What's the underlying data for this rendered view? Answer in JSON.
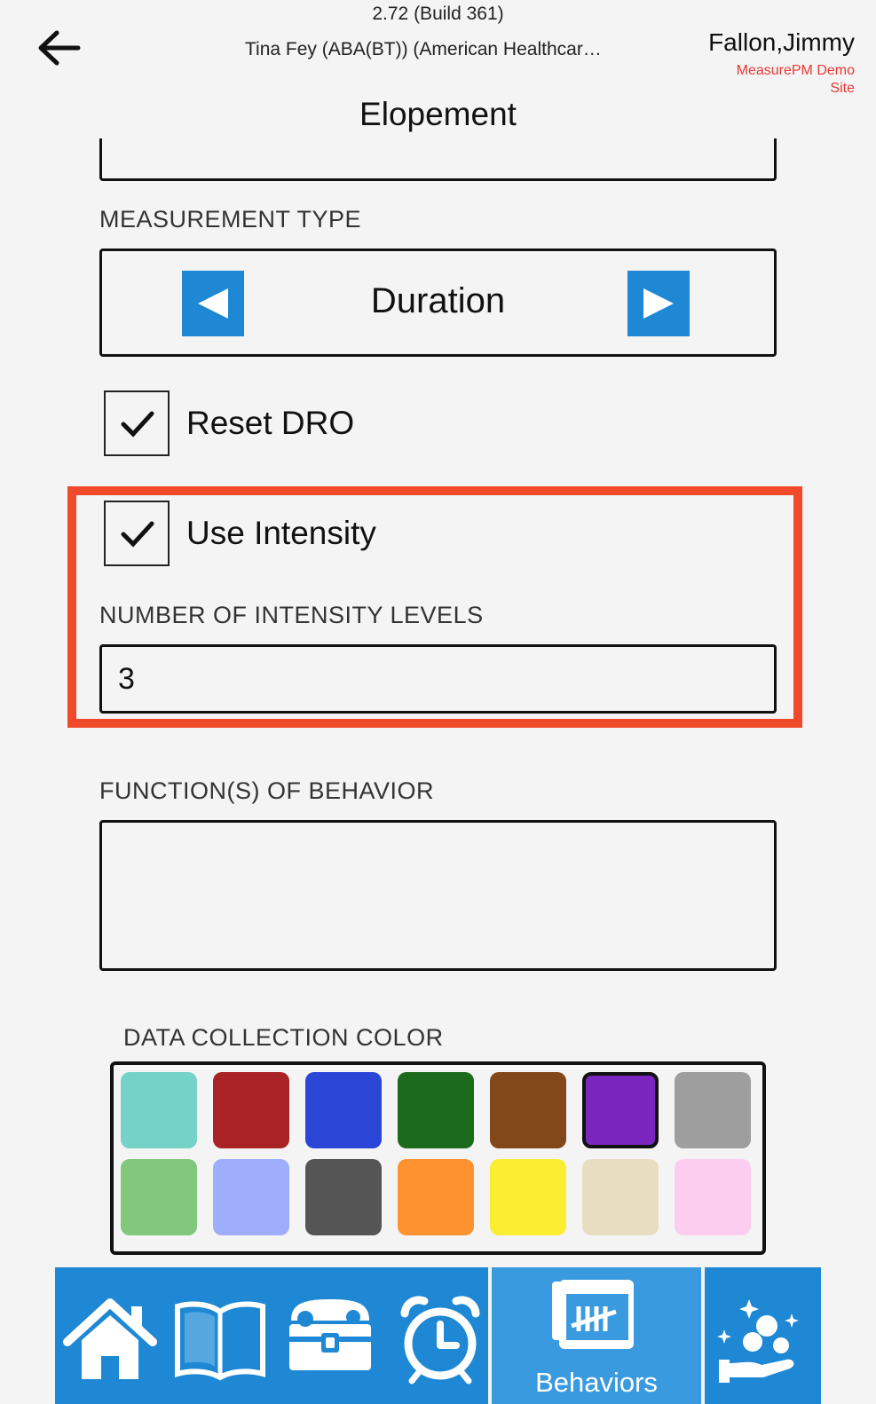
{
  "header": {
    "version": "2.72 (Build 361)",
    "client": "Tina Fey (ABA(BT)) (American Healthcar…",
    "user": "Fallon,Jimmy",
    "site_line1": "MeasurePM Demo",
    "site_line2": "Site",
    "back_icon": "arrow-left-icon"
  },
  "behavior": {
    "name": "Elopement"
  },
  "measurement": {
    "label": "MEASUREMENT TYPE",
    "value": "Duration"
  },
  "reset_dro": {
    "label": "Reset DRO",
    "checked": true
  },
  "intensity": {
    "label": "Use Intensity",
    "checked": true,
    "levels_label": "NUMBER OF INTENSITY LEVELS",
    "levels_value": "3"
  },
  "functions": {
    "label": "FUNCTION(S) OF BEHAVIOR",
    "value": ""
  },
  "color": {
    "label": "DATA COLLECTION COLOR",
    "selected": "#7a26be",
    "swatches": [
      "#74d3c6",
      "#a82226",
      "#2b45d6",
      "#1c6b1c",
      "#82481a",
      "#7a26be",
      "#9e9e9e",
      "#81c77c",
      "#9eaefc",
      "#555555",
      "#fd922e",
      "#fbed31",
      "#e7dec2",
      "#fdcdf0"
    ]
  },
  "colors": {
    "accent": "#1e88d4",
    "highlight": "#f04a2b",
    "site": "#e53935"
  },
  "tabs": {
    "items": [
      "home-icon",
      "book-icon",
      "toolbox-icon",
      "alarm-clock-icon",
      "tally-calendar-icon",
      "stars-hand-icon"
    ],
    "active_label": "Behaviors"
  }
}
